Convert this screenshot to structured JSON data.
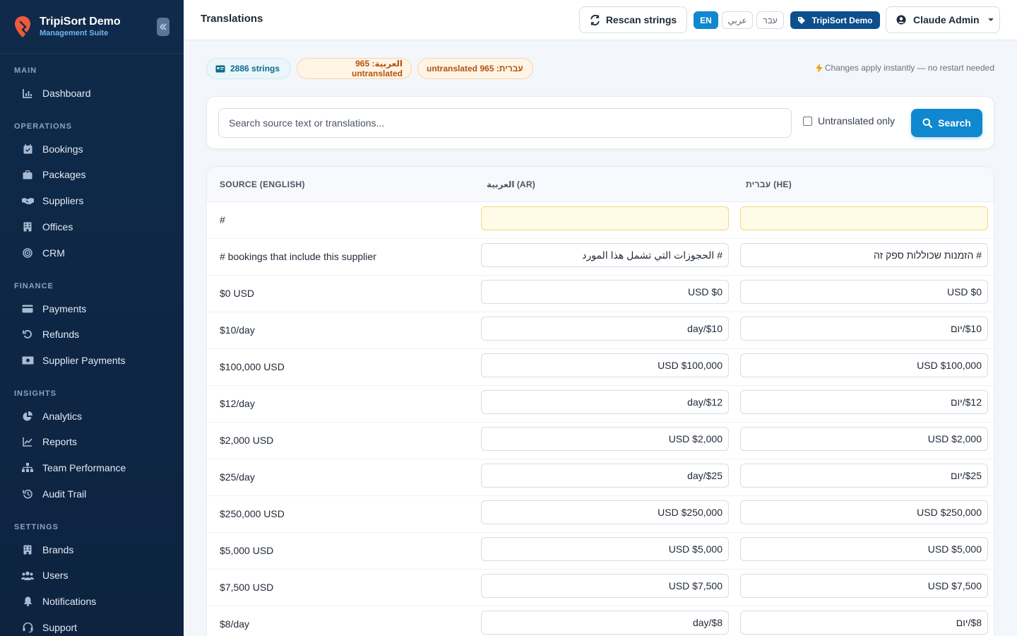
{
  "sidebar": {
    "brand_title": "TripiSort Demo",
    "brand_subtitle": "Management Suite",
    "sections": [
      {
        "label": "MAIN",
        "items": [
          {
            "label": "Dashboard",
            "icon": "dashboard-icon"
          }
        ]
      },
      {
        "label": "OPERATIONS",
        "items": [
          {
            "label": "Bookings",
            "icon": "calendar-check-icon"
          },
          {
            "label": "Packages",
            "icon": "suitcase-icon"
          },
          {
            "label": "Suppliers",
            "icon": "handshake-icon"
          },
          {
            "label": "Offices",
            "icon": "building-icon"
          },
          {
            "label": "CRM",
            "icon": "bullseye-icon"
          }
        ]
      },
      {
        "label": "FINANCE",
        "items": [
          {
            "label": "Payments",
            "icon": "credit-card-icon"
          },
          {
            "label": "Refunds",
            "icon": "undo-icon"
          },
          {
            "label": "Supplier Payments",
            "icon": "money-bill-icon"
          }
        ]
      },
      {
        "label": "INSIGHTS",
        "items": [
          {
            "label": "Analytics",
            "icon": "pie-chart-icon"
          },
          {
            "label": "Reports",
            "icon": "line-chart-icon"
          },
          {
            "label": "Team Performance",
            "icon": "sitemap-icon"
          },
          {
            "label": "Audit Trail",
            "icon": "history-icon"
          }
        ]
      },
      {
        "label": "SETTINGS",
        "items": [
          {
            "label": "Brands",
            "icon": "building-icon"
          },
          {
            "label": "Users",
            "icon": "users-icon"
          },
          {
            "label": "Notifications",
            "icon": "bell-icon"
          },
          {
            "label": "Support",
            "icon": "headset-icon"
          }
        ]
      }
    ]
  },
  "header": {
    "title": "Translations",
    "rescan_label": "Rescan strings",
    "lang_en": "EN",
    "lang_ar": "عربي",
    "lang_he": "עבר",
    "brand_badge": "TripiSort Demo",
    "user_name": "Claude Admin"
  },
  "stats": {
    "strings": "2886 strings",
    "ar_untranslated": "العربية: 965 untranslated",
    "he_untranslated": "עברית: 965 untranslated",
    "note": "Changes apply instantly — no restart needed"
  },
  "search": {
    "placeholder": "Search source text or translations...",
    "untranslated_only": "Untranslated only",
    "button": "Search"
  },
  "table": {
    "headers": {
      "source": "SOURCE (ENGLISH)",
      "ar": "العربية (AR)",
      "he": "עברית (HE)"
    },
    "rows": [
      {
        "source": "#",
        "ar": "",
        "he": ""
      },
      {
        "source": "# bookings that include this supplier",
        "ar": "# الحجوزات التي تشمل هذا المورد",
        "he": "# הזמנות שכוללות ספק זה"
      },
      {
        "source": "$0 USD",
        "ar": "$0 USD",
        "he": "$0 USD"
      },
      {
        "source": "$10/day",
        "ar": "$10/day",
        "he": "$10/יום"
      },
      {
        "source": "$100,000 USD",
        "ar": "$100,000 USD",
        "he": "$100,000 USD"
      },
      {
        "source": "$12/day",
        "ar": "$12/day",
        "he": "$12/יום"
      },
      {
        "source": "$2,000 USD",
        "ar": "$2,000 USD",
        "he": "$2,000 USD"
      },
      {
        "source": "$25/day",
        "ar": "$25/day",
        "he": "$25/יום"
      },
      {
        "source": "$250,000 USD",
        "ar": "$250,000 USD",
        "he": "$250,000 USD"
      },
      {
        "source": "$5,000 USD",
        "ar": "$5,000 USD",
        "he": "$5,000 USD"
      },
      {
        "source": "$7,500 USD",
        "ar": "$7,500 USD",
        "he": "$7,500 USD"
      },
      {
        "source": "$8/day",
        "ar": "$8/day",
        "he": "$8/יום"
      }
    ]
  },
  "colors": {
    "sidebar_bg": "#0f2a4a",
    "accent": "#0f88cf",
    "brand_badge": "#0d4f8c",
    "warning_pill": "#fff4e6",
    "untranslated_field": "#fffbe6"
  }
}
